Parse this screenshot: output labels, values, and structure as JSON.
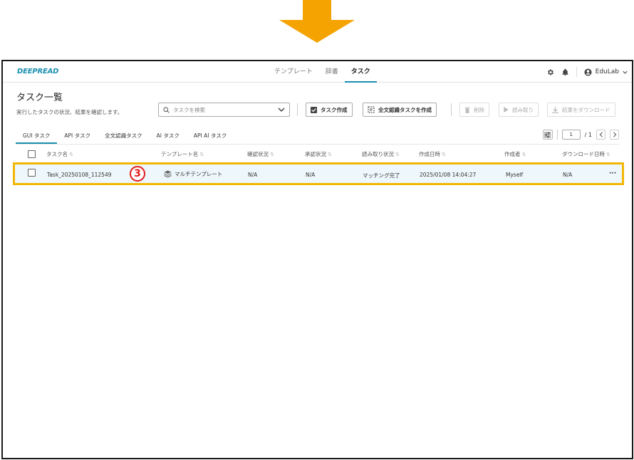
{
  "app": {
    "logo": "DEEPREAD",
    "nav": [
      "テンプレート",
      "辞書",
      "タスク"
    ],
    "user": "EduLab"
  },
  "page": {
    "title": "タスク一覧",
    "subtitle": "実行したタスクの状況、結果を確認します。"
  },
  "search": {
    "placeholder": "タスクを検索"
  },
  "toolbar": {
    "create": "タスク作成",
    "fulltext_create": "全文認識タスクを作成",
    "delete": "削除",
    "read": "読み取り",
    "download": "結果をダウンロード"
  },
  "tabs": [
    "GUI タスク",
    "API タスク",
    "全文認識タスク",
    "AI タスク",
    "API AI タスク"
  ],
  "pager": {
    "current": "1",
    "total": "/ 1"
  },
  "table": {
    "headers": [
      "タスク名",
      "テンプレート名",
      "確認状況",
      "承認状況",
      "読み取り状況",
      "作成日時",
      "作成者",
      "ダウンロード日時"
    ],
    "rows": [
      {
        "name": "Task_20250108_112549",
        "template": "マルチテンプレート",
        "confirm": "N/A",
        "approve": "N/A",
        "read": "マッチング完了",
        "created": "2025/01/08 14:04:27",
        "creator": "Myself",
        "downloaded": "N/A",
        "more": "···"
      }
    ]
  },
  "annotation": {
    "step": "3"
  },
  "colors": {
    "accent": "#1a8fb0",
    "highlight": "#f2b705",
    "arrow": "#f5a300",
    "marker": "#e31a1a"
  }
}
